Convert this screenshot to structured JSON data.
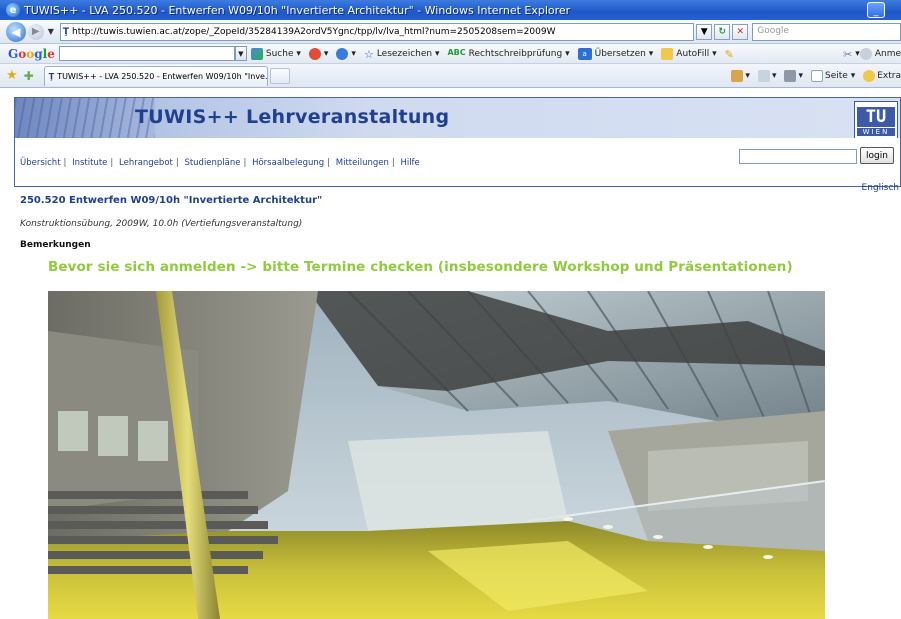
{
  "window": {
    "title": "TUWIS++ - LVA 250.520 - Entwerfen W09/10h \"Invertierte Architektur\" - Windows Internet Explorer"
  },
  "address_bar": {
    "url": "http://tuwis.tuwien.ac.at/zope/_ZopeId/35284139A2ordV5Ygnc/tpp/lv/lva_html?num=2505208sem=2009W",
    "search_placeholder": "Google"
  },
  "google_toolbar": {
    "logo": "Google",
    "items": {
      "suche": "Suche",
      "lesezeichen": "Lesezeichen",
      "rechtschreib": "Rechtschreibprüfung",
      "uebersetzen": "Übersetzen",
      "autofill": "AutoFill",
      "anmelden": "Anme"
    }
  },
  "tabs": {
    "active_tab": "TUWIS++ - LVA 250.520 - Entwerfen W09/10h \"Inve..."
  },
  "command_bar": {
    "seite": "Seite",
    "extras": "Extra"
  },
  "page": {
    "banner_title": "TUWIS++ Lehrveranstaltung",
    "logo_tu": "TU",
    "logo_wien": "WIEN",
    "nav": [
      "Übersicht",
      "Institute",
      "Lehrangebot",
      "Studienpläne",
      "Hörsaalbelegung",
      "Mitteilungen",
      "Hilfe"
    ],
    "login_label": "login",
    "language_link": "Englisch",
    "lva_title": "250.520 Entwerfen W09/10h \"Invertierte Architektur\"",
    "lva_info": "Konstruktionsübung, 2009W, 10.0h (Vertiefungsveranstaltung)",
    "remarks_heading": "Bemerkungen",
    "notice": "Bevor sie sich anmelden -> bitte Termine checken (insbesondere Workshop und Präsentationen)"
  },
  "colors": {
    "accent_blue": "#1f3f8f",
    "notice_green": "#8fcb3c"
  }
}
